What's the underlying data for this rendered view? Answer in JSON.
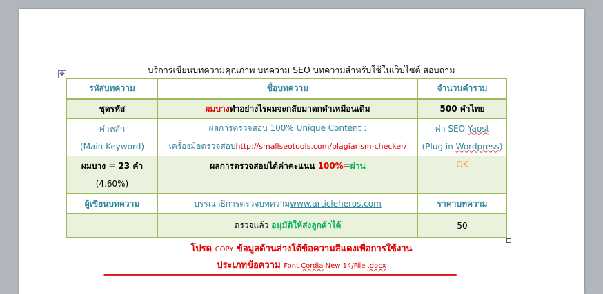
{
  "doc": {
    "title": "บริการเขียนบทความคุณภาพ บทความ SEO บทความสำหรับใช้ในเว็บไซต์ สอบถาม",
    "move_icon": "✥"
  },
  "table": {
    "headers": [
      "รหัสบทความ",
      "ชื่อบทความ",
      "จำนวนคำรวม"
    ],
    "row1": {
      "code": "ชุดรหัส",
      "title_red": "ผมบาง",
      "title_rest": "ทำอย่างไรผมจะกลับมาดกดำเหมือนเดิม",
      "count": "500 คำไทย"
    },
    "row2": {
      "keyword_line1": "คำหลัก",
      "keyword_line2": "(Main Keyword)",
      "check_line1": "ผลการตรวจสอบ 100% Unique Content :",
      "check_tool": "เครื่องมือตรวจสอบ",
      "check_url": "http://smallseotools.com/plagiarism-checker/",
      "seo_prefix": "ค่า SEO ",
      "seo_yoast": "Yaost",
      "plugin_open": "(Plug in ",
      "plugin_wp": "Wordpress",
      "plugin_close": ")"
    },
    "row3": {
      "kw_line1": "ผมบาง = 23 คำ",
      "kw_line2": "(4.60%)",
      "score_text": "ผลการตรวจสอบได้ค่าคะแนน ",
      "score_value": "100%",
      "score_eq": "=",
      "score_pass": "ผ่าน",
      "ok": "OK"
    },
    "row4": {
      "writer_label": "ผู้เขียนบทความ",
      "editor_text": "บรรณาธิการตรวจบทความ",
      "editor_site": "www.articleheros.com",
      "price_label": "ราคาบทความ"
    },
    "row5": {
      "checked": "ตรวจแล้ว ",
      "approved": "อนุมัติให้ส่งลูกค้าได้",
      "price": "50"
    }
  },
  "notes": {
    "line1_a": "โปรด ",
    "line1_copy": "COPY",
    "line1_b": " ข้อมูลด้านล่างใต้ข้อความสีแดงเพื่อการใช้งาน",
    "line2_a": "ประเภทข้อความ ",
    "line2_font": "Font ",
    "line2_cordia": "Cordia",
    "line2_new": " New 14/File ",
    "line2_docx": ".docx",
    "separator": "================================================================================================"
  }
}
